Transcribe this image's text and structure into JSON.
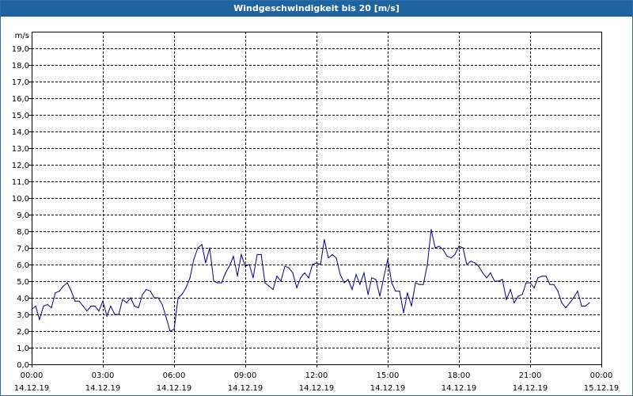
{
  "window": {
    "title": "Windgeschwindigkeit bis 20 [m/s]"
  },
  "chart_data": {
    "type": "line",
    "title": "Windgeschwindigkeit bis 20 [m/s]",
    "ylabel": "m/s",
    "ylim": [
      0,
      20
    ],
    "y_ticks": [
      "0,0",
      "1,0",
      "2,0",
      "3,0",
      "4,0",
      "5,0",
      "6,0",
      "7,0",
      "8,0",
      "9,0",
      "10,0",
      "11,0",
      "12,0",
      "13,0",
      "14,0",
      "15,0",
      "16,0",
      "17,0",
      "18,0",
      "19,0"
    ],
    "x_ticks": [
      {
        "time": "00:00",
        "date": "14.12.19"
      },
      {
        "time": "03:00",
        "date": "14.12.19"
      },
      {
        "time": "06:00",
        "date": "14.12.19"
      },
      {
        "time": "09:00",
        "date": "14.12.19"
      },
      {
        "time": "12:00",
        "date": "14.12.19"
      },
      {
        "time": "15:00",
        "date": "14.12.19"
      },
      {
        "time": "18:00",
        "date": "14.12.19"
      },
      {
        "time": "21:00",
        "date": "14.12.19"
      },
      {
        "time": "00:00",
        "date": "15.12.19"
      }
    ],
    "xlim_hours": [
      0,
      24
    ],
    "grid": true,
    "line_color": "#00008b",
    "series": [
      {
        "hours": [
          0,
          0.17,
          0.33,
          0.5,
          0.67,
          0.83,
          1,
          1.17,
          1.33,
          1.5,
          1.67,
          1.83,
          2,
          2.17,
          2.33,
          2.5,
          2.67,
          2.83,
          3,
          3.17,
          3.33,
          3.5,
          3.67,
          3.83,
          4,
          4.17,
          4.33,
          4.5,
          4.67,
          4.83,
          5,
          5.17,
          5.33,
          5.5,
          5.67,
          5.83,
          6,
          6.17,
          6.33,
          6.5,
          6.67,
          6.83,
          7,
          7.17,
          7.33,
          7.5,
          7.67,
          7.83,
          8,
          8.17,
          8.33,
          8.5,
          8.67,
          8.83,
          9,
          9.17,
          9.33,
          9.5,
          9.67,
          9.83,
          10,
          10.17,
          10.33,
          10.5,
          10.67,
          10.83,
          11,
          11.17,
          11.33,
          11.5,
          11.67,
          11.83,
          12,
          12.17,
          12.33,
          12.5,
          12.67,
          12.83,
          13,
          13.17,
          13.33,
          13.5,
          13.67,
          13.83,
          14,
          14.17,
          14.33,
          14.5,
          14.67,
          14.83,
          15,
          15.17,
          15.33,
          15.5,
          15.67,
          15.83,
          16,
          16.17,
          16.33,
          16.5,
          16.67,
          16.83,
          17,
          17.17,
          17.33,
          17.5,
          17.67,
          17.83,
          18,
          18.17,
          18.33,
          18.5,
          18.67,
          18.83,
          19,
          19.17,
          19.33,
          19.5,
          19.67,
          19.83,
          20,
          20.17,
          20.33,
          20.5,
          20.67,
          20.83,
          21,
          21.17,
          21.33,
          21.5,
          21.67,
          21.83,
          22,
          22.17,
          22.33,
          22.5,
          22.67,
          22.83,
          23,
          23.17,
          23.33,
          23.5
        ],
        "values": [
          3.3,
          3.5,
          2.7,
          3.5,
          3.6,
          3.4,
          4.3,
          4.4,
          4.7,
          4.9,
          4.4,
          3.8,
          3.8,
          3.5,
          3.2,
          3.5,
          3.5,
          3.2,
          3.8,
          2.9,
          3.5,
          3.0,
          3.0,
          3.9,
          3.7,
          4.0,
          3.5,
          3.4,
          4.2,
          4.5,
          4.4,
          4.0,
          4.0,
          3.6,
          2.8,
          2.0,
          2.1,
          4.0,
          4.2,
          4.6,
          5.2,
          6.3,
          7.0,
          7.2,
          6.1,
          7.0,
          5.0,
          4.9,
          4.9,
          5.5,
          5.9,
          6.5,
          5.3,
          6.6,
          5.9,
          6.0,
          5.2,
          6.6,
          6.6,
          4.9,
          4.7,
          4.5,
          5.3,
          5.0,
          5.9,
          5.8,
          5.5,
          4.6,
          5.2,
          5.5,
          5.2,
          6.0,
          6.1,
          6.0,
          7.5,
          6.4,
          6.6,
          6.4,
          5.4,
          4.9,
          5.1,
          4.5,
          5.4,
          4.8,
          5.5,
          4.2,
          5.2,
          5.1,
          4.1,
          5.2,
          6.3,
          4.9,
          4.4,
          4.4,
          3.1,
          4.3,
          3.5,
          4.9,
          4.8,
          4.8,
          6.0,
          8.1,
          7.0,
          7.1,
          6.9,
          6.5,
          6.4,
          6.6,
          7.1,
          7.0,
          6.0,
          6.2,
          6.1,
          5.9,
          5.5,
          5.2,
          5.5,
          5.0,
          5.0,
          5.1,
          3.9,
          4.5,
          3.7,
          4.1,
          4.2,
          4.9,
          4.9,
          4.6,
          5.2,
          5.3,
          5.3,
          4.8,
          4.8,
          4.4,
          3.7,
          3.4,
          3.7,
          4.0,
          4.4,
          3.5,
          3.5,
          3.7,
          3.2,
          2.9
        ]
      }
    ]
  }
}
